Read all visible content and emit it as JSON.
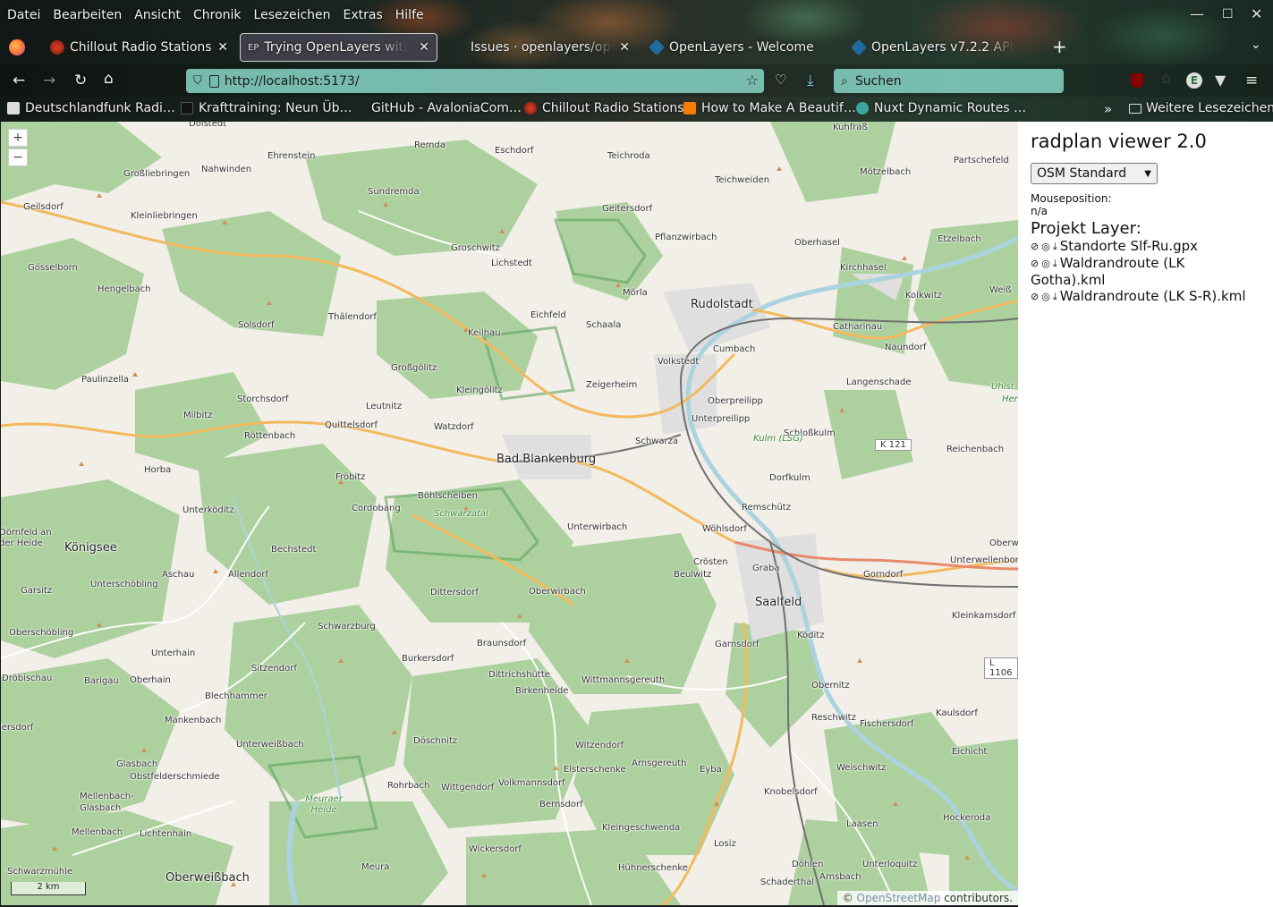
{
  "menubar": {
    "items": [
      "Datei",
      "Bearbeiten",
      "Ansicht",
      "Chronik",
      "Lesezeichen",
      "Extras",
      "Hilfe"
    ]
  },
  "tabs": [
    {
      "label": "Chillout Radio Stations",
      "active": false
    },
    {
      "label": "Trying OpenLayers with",
      "active": true,
      "icon_text": "EP"
    },
    {
      "label": "Issues · openlayers/ope",
      "active": false
    },
    {
      "label": "OpenLayers - Welcome",
      "active": false
    },
    {
      "label": "OpenLayers v7.2.2 API -",
      "active": false
    }
  ],
  "navbar": {
    "url": "http://localhost:5173/",
    "search_placeholder": "Suchen"
  },
  "bookmarks": [
    "Deutschlandfunk Radi…",
    "Krafttraining: Neun Üb…",
    "GitHub - AvaloniaCom…",
    "Chillout Radio Stations",
    "How to Make A Beautif…",
    "Nuxt Dynamic Routes …"
  ],
  "bookmarks_more": "Weitere Lesezeichen",
  "map": {
    "zoom_in": "+",
    "zoom_out": "−",
    "scale_label": "2 km",
    "attribution_prefix": "©",
    "attribution_link": "OpenStreetMap",
    "attribution_suffix": "contributors.",
    "places": [
      {
        "name": "Dolstedt"
      },
      {
        "name": "Remda"
      },
      {
        "name": "Eschdorf"
      },
      {
        "name": "Teichroda"
      },
      {
        "name": "Kuhfraß"
      },
      {
        "name": "Partschefeld"
      },
      {
        "name": "Ehrenstein"
      },
      {
        "name": "Großliebringen"
      },
      {
        "name": "Nahwinden"
      },
      {
        "name": "Sundremda"
      },
      {
        "name": "Teichweiden"
      },
      {
        "name": "Mötzelbach"
      },
      {
        "name": "Geilsdorf"
      },
      {
        "name": "Kleinliebringen"
      },
      {
        "name": "Geitersdorf"
      },
      {
        "name": "Groschwitz"
      },
      {
        "name": "Pflanzwirbach"
      },
      {
        "name": "Oberhasel"
      },
      {
        "name": "Etzelbach"
      },
      {
        "name": "Gösselborn"
      },
      {
        "name": "Lichstedt"
      },
      {
        "name": "Kirchhasel"
      },
      {
        "name": "Hengelbach"
      },
      {
        "name": "Mörla"
      },
      {
        "name": "Kolkwitz"
      },
      {
        "name": "Weiß"
      },
      {
        "name": "Rudolstadt",
        "town": true
      },
      {
        "name": "Thälendorf"
      },
      {
        "name": "Eichfeld"
      },
      {
        "name": "Schaala"
      },
      {
        "name": "Solsdorf"
      },
      {
        "name": "Keilhau"
      },
      {
        "name": "Catharinau"
      },
      {
        "name": "Cumbach"
      },
      {
        "name": "Naundorf"
      },
      {
        "name": "Volkstedt"
      },
      {
        "name": "Großgölitz"
      },
      {
        "name": "Paulinzella"
      },
      {
        "name": "Storchsdorf"
      },
      {
        "name": "Kleingölitz"
      },
      {
        "name": "Zeigerheim"
      },
      {
        "name": "Langenschade"
      },
      {
        "name": "Uhlst"
      },
      {
        "name": "Her"
      },
      {
        "name": "Oberpreilipp"
      },
      {
        "name": "Milbitz"
      },
      {
        "name": "Leutnitz"
      },
      {
        "name": "Unterpreilipp"
      },
      {
        "name": "Quittelsdorf"
      },
      {
        "name": "Watzdorf"
      },
      {
        "name": "Schloßkulm"
      },
      {
        "name": "Röttenbach"
      },
      {
        "name": "Schwarza"
      },
      {
        "name": "Kulm (LSG)"
      },
      {
        "name": "K 121"
      },
      {
        "name": "Reichenbach"
      },
      {
        "name": "Bad Blankenburg",
        "town": true
      },
      {
        "name": "Horba"
      },
      {
        "name": "Fröbitz"
      },
      {
        "name": "Böhlscheiben"
      },
      {
        "name": "Dorfkulm"
      },
      {
        "name": "Cordobang"
      },
      {
        "name": "Schwarzatal"
      },
      {
        "name": "Unterköditz"
      },
      {
        "name": "Remschütz"
      },
      {
        "name": "Dörnfeld an der Heide"
      },
      {
        "name": "Königsee",
        "town": true
      },
      {
        "name": "Bechstedt"
      },
      {
        "name": "Unterwirbach"
      },
      {
        "name": "Wöhlsdorf"
      },
      {
        "name": "Oberw"
      },
      {
        "name": "Aschau"
      },
      {
        "name": "Allendorf"
      },
      {
        "name": "Crösten"
      },
      {
        "name": "Unterwellenborn"
      },
      {
        "name": "Garsitz"
      },
      {
        "name": "Unterschöbling"
      },
      {
        "name": "Beulwitz"
      },
      {
        "name": "Graba"
      },
      {
        "name": "Gorndorf"
      },
      {
        "name": "Dittersdorf"
      },
      {
        "name": "Oberwirbach"
      },
      {
        "name": "Saalfeld",
        "town": true
      },
      {
        "name": "Kleinkamsdorf"
      },
      {
        "name": "Schwarzburg"
      },
      {
        "name": "Oberschöbling"
      },
      {
        "name": "Braunsdorf"
      },
      {
        "name": "Köditz"
      },
      {
        "name": "Garnsdorf"
      },
      {
        "name": "Unterhain"
      },
      {
        "name": "Burkersdorf"
      },
      {
        "name": "L 1106"
      },
      {
        "name": "Sitzendorf"
      },
      {
        "name": "Dittrichshütte"
      },
      {
        "name": "Dröbischau"
      },
      {
        "name": "Barigau"
      },
      {
        "name": "Oberhain"
      },
      {
        "name": "Wittmannsgereuth"
      },
      {
        "name": "Birkenheide"
      },
      {
        "name": "Obernitz"
      },
      {
        "name": "Blechhammer"
      },
      {
        "name": "Kaulsdorf"
      },
      {
        "name": "Reschwitz"
      },
      {
        "name": "Mankenbach"
      },
      {
        "name": "lersdorf"
      },
      {
        "name": "Fischersdorf"
      },
      {
        "name": "Unterweißbach"
      },
      {
        "name": "Döschnitz"
      },
      {
        "name": "Witzendorf"
      },
      {
        "name": "Eichicht"
      },
      {
        "name": "Glasbach"
      },
      {
        "name": "Arnsgereuth"
      },
      {
        "name": "Elsterschenke"
      },
      {
        "name": "Eyba"
      },
      {
        "name": "Weischwitz"
      },
      {
        "name": "Obstfelderschmiede"
      },
      {
        "name": "Rohrbach"
      },
      {
        "name": "Volkmannsdorf"
      },
      {
        "name": "Wittgendorf"
      },
      {
        "name": "Mellenbach-Glasbach"
      },
      {
        "name": "Meuraer Heide"
      },
      {
        "name": "Knobelsdorf"
      },
      {
        "name": "Bernsdorf"
      },
      {
        "name": "Hockeroda"
      },
      {
        "name": "Mellenbach"
      },
      {
        "name": "Lichtenhain"
      },
      {
        "name": "Kleingeschwenda"
      },
      {
        "name": "Laasen"
      },
      {
        "name": "Losiz"
      },
      {
        "name": "Wickersdorf"
      },
      {
        "name": "Döhlen"
      },
      {
        "name": "Unterloquitz"
      },
      {
        "name": "Meura"
      },
      {
        "name": "Hühnerschenke"
      },
      {
        "name": "Schwarzmühle"
      },
      {
        "name": "Oberweißbach",
        "town": true
      },
      {
        "name": "Schaderthal"
      },
      {
        "name": "Arnsbach"
      }
    ]
  },
  "sidebar": {
    "title": "radplan viewer 2.0",
    "layer_select_value": "OSM Standard",
    "mouse_label": "Mouseposition:",
    "mouse_value": "n/a",
    "project_title": "Projekt Layer:",
    "layers": [
      {
        "label": "Standorte Slf-Ru.gpx"
      },
      {
        "label": "Waldrandroute (LK Gotha).kml"
      },
      {
        "label": "Waldrandroute (LK S-R).kml"
      }
    ]
  },
  "colors": {
    "urlbar": "#80c9bb",
    "map_bg": "#f2efe9",
    "forest": "#add19e",
    "primary_road": "#f3b95c",
    "railway": "#707070",
    "water": "#aad3df"
  }
}
